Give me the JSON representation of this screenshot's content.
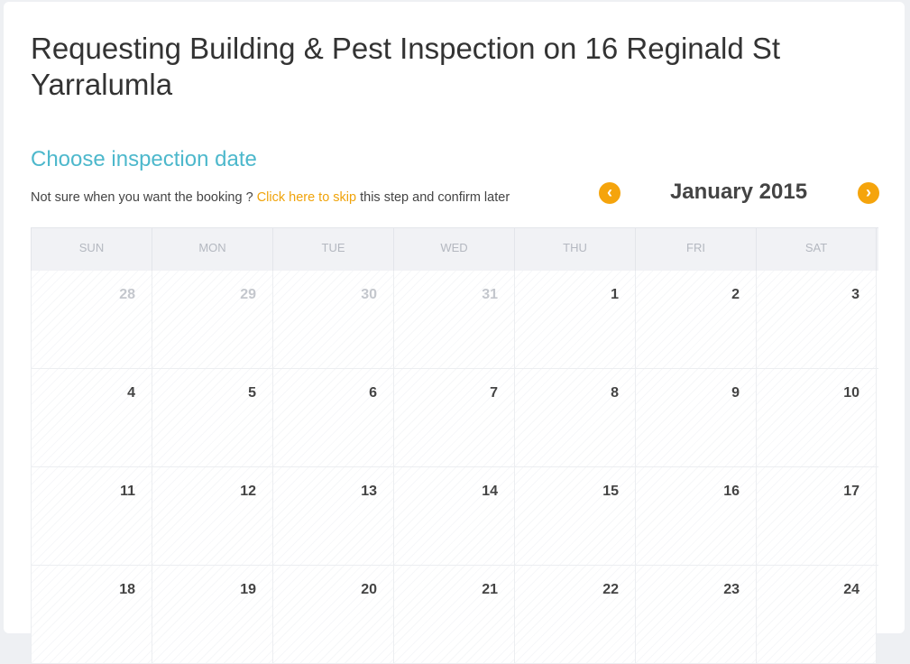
{
  "page": {
    "title": "Requesting Building & Pest Inspection on 16 Reginald St Yarralumla",
    "section_title": "Choose inspection date",
    "note_prefix": "Not sure when you want the booking ? ",
    "note_link": "Click here to skip",
    "note_suffix": " this step and confirm later"
  },
  "calendar": {
    "month_label": "January 2015",
    "prev_icon": "‹",
    "next_icon": "›",
    "weekdays": [
      "SUN",
      "MON",
      "TUE",
      "WED",
      "THU",
      "FRI",
      "SAT"
    ],
    "weeks": [
      [
        {
          "d": "28",
          "other": true
        },
        {
          "d": "29",
          "other": true
        },
        {
          "d": "30",
          "other": true
        },
        {
          "d": "31",
          "other": true
        },
        {
          "d": "1"
        },
        {
          "d": "2"
        },
        {
          "d": "3"
        }
      ],
      [
        {
          "d": "4"
        },
        {
          "d": "5"
        },
        {
          "d": "6"
        },
        {
          "d": "7"
        },
        {
          "d": "8"
        },
        {
          "d": "9"
        },
        {
          "d": "10"
        }
      ],
      [
        {
          "d": "11"
        },
        {
          "d": "12"
        },
        {
          "d": "13"
        },
        {
          "d": "14"
        },
        {
          "d": "15"
        },
        {
          "d": "16"
        },
        {
          "d": "17"
        }
      ],
      [
        {
          "d": "18"
        },
        {
          "d": "19"
        },
        {
          "d": "20"
        },
        {
          "d": "21"
        },
        {
          "d": "22"
        },
        {
          "d": "23"
        },
        {
          "d": "24"
        }
      ]
    ]
  },
  "colors": {
    "accent_teal": "#4db8cc",
    "accent_orange": "#f5a40c",
    "link_orange": "#f0a30a",
    "text_dark": "#333333",
    "muted_day": "#c4c7cd"
  }
}
